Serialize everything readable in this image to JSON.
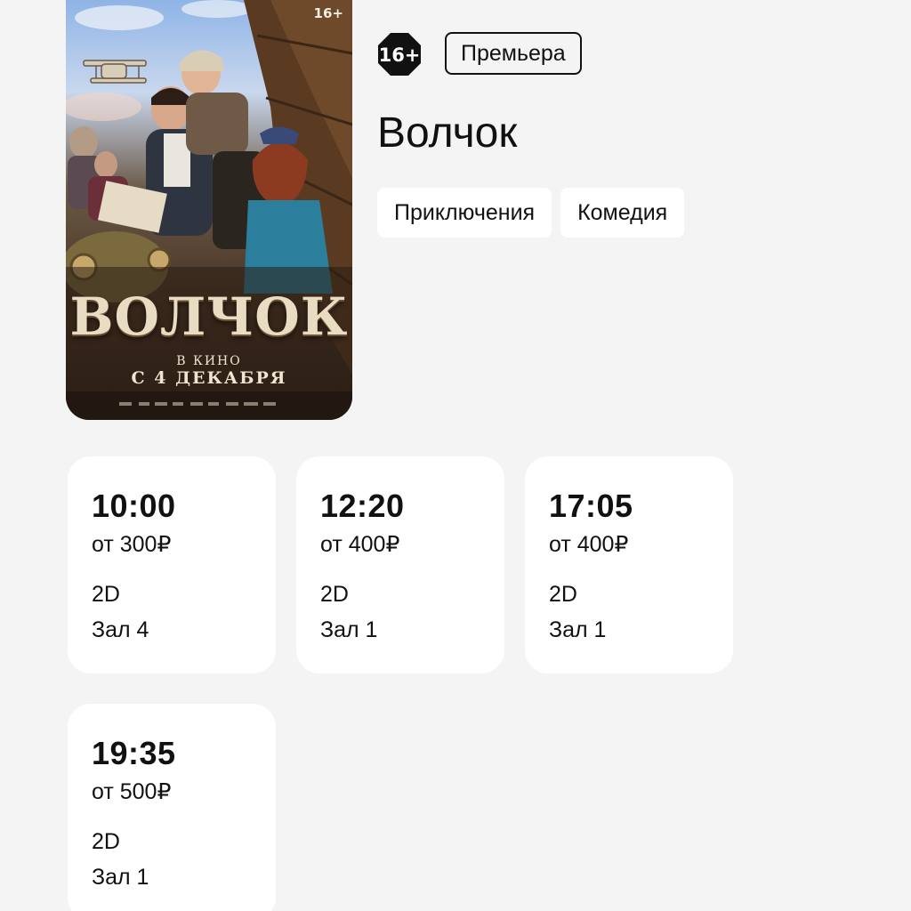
{
  "poster": {
    "rating": "16+",
    "title": "ВОЛЧОК",
    "subtitle_line1": "В КИНО",
    "subtitle_line2": "С 4 ДЕКАБРЯ"
  },
  "movie": {
    "age_rating": "16+",
    "premiere_label": "Премьера",
    "title": "Волчок",
    "genres": [
      "Приключения",
      "Комедия"
    ]
  },
  "sessions": [
    {
      "time": "10:00",
      "price": "от 300₽",
      "format": "2D",
      "hall": "Зал 4"
    },
    {
      "time": "12:20",
      "price": "от 400₽",
      "format": "2D",
      "hall": "Зал 1"
    },
    {
      "time": "17:05",
      "price": "от 400₽",
      "format": "2D",
      "hall": "Зал 1"
    },
    {
      "time": "19:35",
      "price": "от 500₽",
      "format": "2D",
      "hall": "Зал 1"
    }
  ],
  "colors": {
    "background": "#f4f4f4",
    "card": "#ffffff",
    "text": "#111111"
  },
  "icons": {
    "age_rating": "age-rating-octagon-icon"
  }
}
